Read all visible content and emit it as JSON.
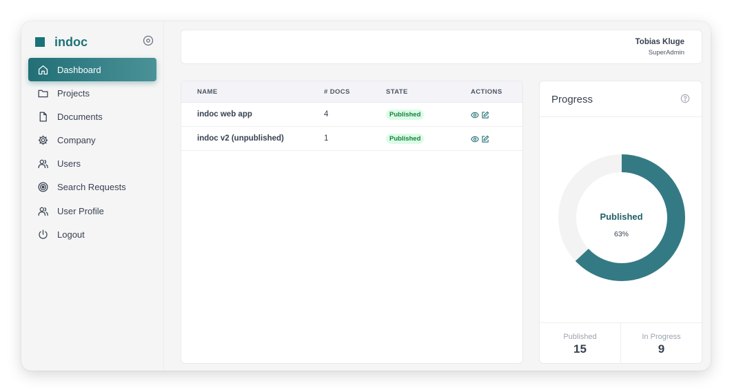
{
  "brand": {
    "name": "indoc",
    "accent": "#1a7379"
  },
  "sidebar": {
    "items": [
      {
        "label": "Dashboard",
        "icon": "home-icon",
        "active": true
      },
      {
        "label": "Projects",
        "icon": "folder-icon"
      },
      {
        "label": "Documents",
        "icon": "document-icon"
      },
      {
        "label": "Company",
        "icon": "gear-icon"
      },
      {
        "label": "Users",
        "icon": "users-icon"
      },
      {
        "label": "Search Requests",
        "icon": "target-icon"
      },
      {
        "label": "User Profile",
        "icon": "users-icon"
      },
      {
        "label": "Logout",
        "icon": "power-icon"
      }
    ]
  },
  "header": {
    "user_name": "Tobias Kluge",
    "user_role": "SuperAdmin"
  },
  "table": {
    "columns": [
      "NAME",
      "# DOCS",
      "STATE",
      "ACTIONS"
    ],
    "rows": [
      {
        "name": "indoc web app",
        "docs": "4",
        "state": "Published"
      },
      {
        "name": "indoc v2 (unpublished)",
        "docs": "1",
        "state": "Published"
      }
    ]
  },
  "progress": {
    "title": "Progress",
    "center_label": "Published",
    "center_value": "63%",
    "published_fraction": 0.63,
    "colors": {
      "published": "#347a84",
      "remaining": "#f2f3f2"
    },
    "stats": [
      {
        "label": "Published",
        "value": "15"
      },
      {
        "label": "In Progress",
        "value": "9"
      }
    ]
  }
}
